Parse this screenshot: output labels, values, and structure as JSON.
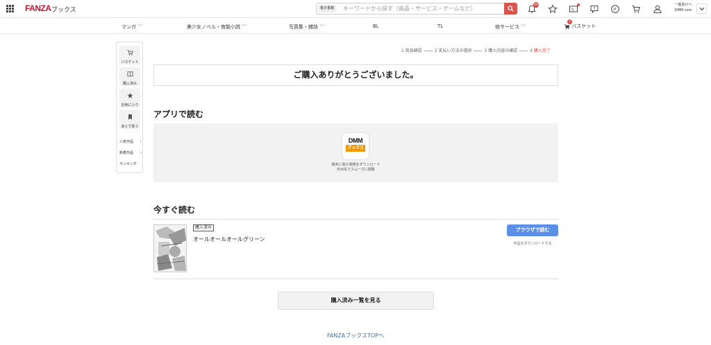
{
  "header": {
    "logo": "FANZA",
    "logo_sub": "ブックス",
    "search": {
      "category": "電子書籍",
      "placeholder": "キーワードから探す（商品・サービス・ゲームなど）"
    },
    "notification_count": "10",
    "region_line1": "一般向けへ",
    "region_line2": "DMM.com"
  },
  "nav": {
    "items": [
      {
        "label": "マンガ",
        "has_dropdown": true
      },
      {
        "label": "美少女ノベル・官能小説",
        "has_dropdown": true
      },
      {
        "label": "写真集・雑誌",
        "has_dropdown": true
      },
      {
        "label": "BL",
        "has_dropdown": false
      },
      {
        "label": "TL",
        "has_dropdown": false
      },
      {
        "label": "他サービス",
        "has_dropdown": true
      }
    ],
    "basket_label": "バスケット",
    "basket_count": "2"
  },
  "sidebar": {
    "buttons": [
      {
        "label": "バスケット",
        "icon": "cart-icon"
      },
      {
        "label": "購入済み",
        "icon": "book-icon"
      },
      {
        "label": "お気に入り",
        "icon": "star-icon"
      },
      {
        "label": "あとで買う",
        "icon": "bookmark-icon"
      }
    ],
    "links": [
      "人気作品",
      "新着作品",
      "ランキング"
    ]
  },
  "steps": [
    {
      "label": "1 商品確認",
      "active": false
    },
    {
      "label": "2 支払い方法の選択",
      "active": false
    },
    {
      "label": "3 購入内容の確認",
      "active": false
    },
    {
      "label": "4 購入完了",
      "active": true
    }
  ],
  "thanks_message": "ご購入ありがとうございました。",
  "app_section": {
    "heading": "アプリで読む",
    "icon_text_top": "DMM",
    "icon_text_bottom": "ブックス",
    "desc_line1": "端末に電子書籍をダウンロード",
    "desc_line2": "外出先でスムーズに閲覧"
  },
  "read_now": {
    "heading": "今すぐ読む",
    "item": {
      "badge": "購入済み",
      "title": "オールオールオールグリーン",
      "read_button": "ブラウザで読む",
      "download_link": "作品をダウンロードする"
    }
  },
  "purchased_list_button": "購入済み一覧を見る",
  "top_link": "FANZAブックスTOPへ",
  "colors": {
    "brand": "#c8102e",
    "accent_red": "#e2453c",
    "read_button": "#5b8fe8",
    "link": "#3a6fb0"
  }
}
